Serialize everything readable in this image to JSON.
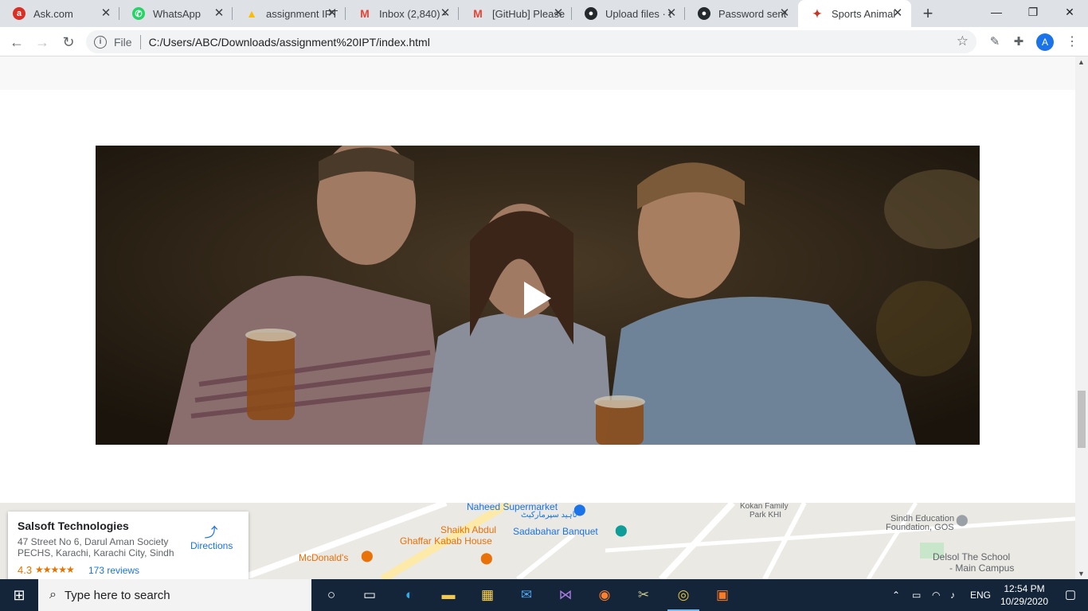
{
  "browser": {
    "tabs": [
      {
        "title": "Ask.com",
        "favicon": "ask-favicon",
        "color": "#d93025"
      },
      {
        "title": "WhatsApp",
        "favicon": "whatsapp-favicon",
        "color": "#25d366"
      },
      {
        "title": "assignment IPT",
        "favicon": "google-drive-favicon",
        "color": "#fbbc04"
      },
      {
        "title": "Inbox (2,840) -",
        "favicon": "gmail-favicon",
        "color": "#ea4335"
      },
      {
        "title": "[GitHub] Please",
        "favicon": "gmail-favicon",
        "color": "#ea4335"
      },
      {
        "title": "Upload files · t",
        "favicon": "github-favicon",
        "color": "#24292e"
      },
      {
        "title": "Password sent",
        "favicon": "github-favicon",
        "color": "#24292e"
      },
      {
        "title": "Sports Animal",
        "favicon": "sports-animal-favicon",
        "color": "#c0392b",
        "active": true
      }
    ],
    "new_tab": "+",
    "window_controls": {
      "minimize": "—",
      "maximize": "❐",
      "close": "✕"
    },
    "address": {
      "info_icon": "i",
      "scheme_label": "File",
      "url": "C:/Users/ABC/Downloads/assignment%20IPT/index.html"
    },
    "profile_initial": "A"
  },
  "page": {
    "video": {
      "play_icon": "play-icon"
    },
    "map": {
      "labels": [
        {
          "text": "Naheed Supermarket",
          "color": "#1a73e8"
        },
        {
          "text": "ناہید سپرمارکیٹ",
          "color": "#1a73e8"
        },
        {
          "text": "Shaikh Abdul",
          "color": "#e8710a"
        },
        {
          "text": "Ghaffar Kabab House",
          "color": "#e8710a"
        },
        {
          "text": "Sadabahar Banquet",
          "color": "#1a73e8"
        },
        {
          "text": "McDonald's",
          "color": "#e8710a"
        },
        {
          "text": "Kokan Family",
          "color": "#5f6368"
        },
        {
          "text": "Park KHI",
          "color": "#5f6368"
        },
        {
          "text": "Sindh Education",
          "color": "#5f6368"
        },
        {
          "text": "Foundation, GOS",
          "color": "#5f6368"
        },
        {
          "text": "Delsol The School",
          "color": "#5f6368"
        },
        {
          "text": "- Main Campus",
          "color": "#5f6368"
        }
      ],
      "card": {
        "name": "Salsoft Technologies",
        "address_line1": "47 Street No 6, Darul Aman Society",
        "address_line2": "PECHS, Karachi, Karachi City, Sindh",
        "rating": "4.3",
        "stars": "★★★★★",
        "reviews": "173 reviews",
        "directions": "Directions"
      }
    }
  },
  "taskbar": {
    "search_placeholder": "Type here to search",
    "tray_language": "ENG",
    "time": "12:54 PM",
    "date": "10/29/2020"
  }
}
